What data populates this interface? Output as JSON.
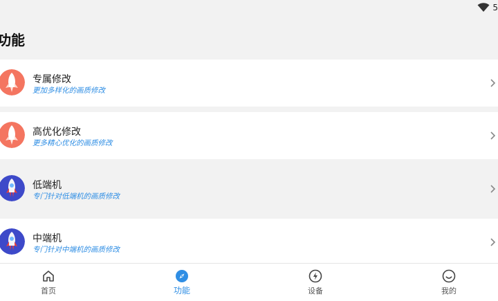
{
  "status": {
    "signal_text": "5"
  },
  "page": {
    "title": "功能"
  },
  "features": [
    {
      "title": "专属修改",
      "subtitle": "更加多样化的画质修改",
      "icon": "rocket-orange-icon"
    },
    {
      "title": "高优化修改",
      "subtitle": "更多精心优化的画质修改",
      "icon": "rocket-orange-icon"
    },
    {
      "title": "低端机",
      "subtitle": "专门针对低端机的画质修改",
      "icon": "rocket-blue-icon"
    },
    {
      "title": "中端机",
      "subtitle": "专门针对中端机的画质修改",
      "icon": "rocket-blue-icon"
    }
  ],
  "tabs": [
    {
      "label": "首页",
      "icon": "home-icon",
      "active": false
    },
    {
      "label": "功能",
      "icon": "compass-icon",
      "active": true
    },
    {
      "label": "设备",
      "icon": "lightning-icon",
      "active": false
    },
    {
      "label": "我的",
      "icon": "smile-icon",
      "active": false
    }
  ],
  "colors": {
    "accent": "#2f8ee4",
    "orange_icon": "#f47560",
    "blue_icon": "#3d49c9",
    "background": "#f2f2f2"
  }
}
